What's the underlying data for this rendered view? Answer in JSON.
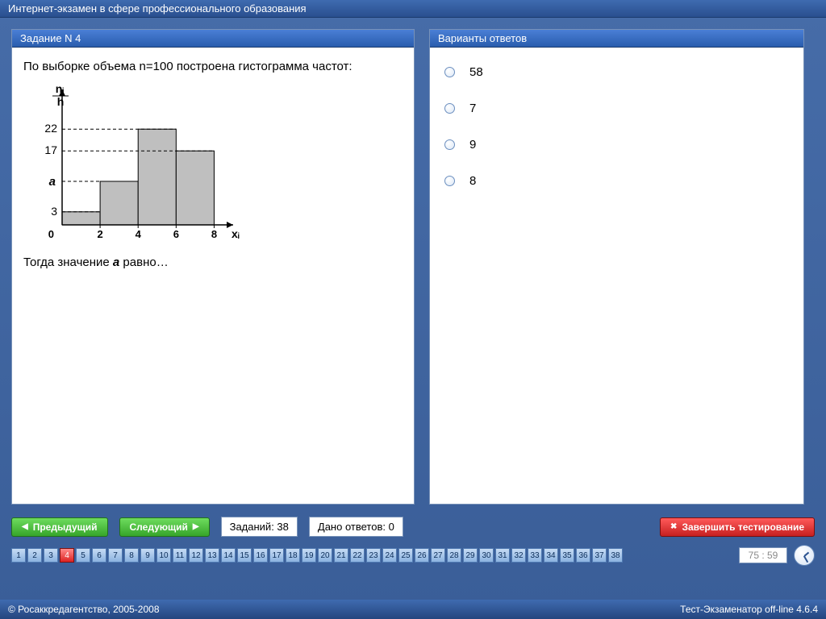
{
  "header": {
    "title": "Интернет-экзамен в сфере профессионального образования"
  },
  "question": {
    "panel_title": "Задание N 4",
    "text": "По выборке объема n=100 построена гистограмма частот:",
    "tail_before": "Тогда значение ",
    "tail_var": "a",
    "tail_after": " равно…"
  },
  "chart_data": {
    "type": "bar",
    "y_axis_label": "nᵢ / h",
    "x_axis_label": "xᵢ",
    "x_ticks": [
      0,
      2,
      4,
      6,
      8
    ],
    "y_ticks_labeled": [
      3,
      17,
      22
    ],
    "y_unknown_label": "a",
    "bars": [
      {
        "x_from": 0,
        "x_to": 2,
        "height_label": "3",
        "height_value": 3
      },
      {
        "x_from": 2,
        "x_to": 4,
        "height_label": "a",
        "height_value": null
      },
      {
        "x_from": 4,
        "x_to": 6,
        "height_label": "22",
        "height_value": 22
      },
      {
        "x_from": 6,
        "x_to": 8,
        "height_label": "17",
        "height_value": 17
      }
    ],
    "ylim": [
      0,
      30
    ],
    "xlim": [
      0,
      9
    ]
  },
  "answers": {
    "panel_title": "Варианты ответов",
    "options": [
      "58",
      "7",
      "9",
      "8"
    ]
  },
  "nav": {
    "prev": "Предыдущий",
    "next": "Следующий",
    "finish": "Завершить тестирование",
    "total_label": "Заданий: 38",
    "given_label": "Дано ответов: 0"
  },
  "strip": {
    "count": 38,
    "active": 4
  },
  "timer": {
    "value": "75 : 59"
  },
  "footer": {
    "left": "© Росаккредагентство, 2005-2008",
    "right": "Тест-Экзаменатор off-line 4.6.4"
  }
}
